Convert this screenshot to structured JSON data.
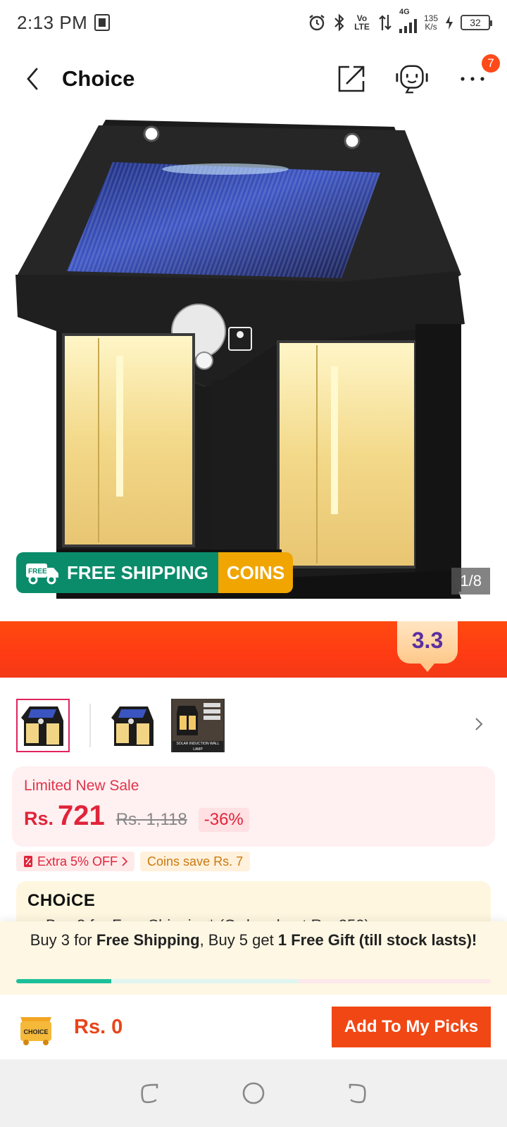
{
  "status_bar": {
    "time": "2:13 PM",
    "volte": "Vo LTE",
    "network": "4G",
    "speed_value": "135",
    "speed_unit": "K/s",
    "battery": "32"
  },
  "header": {
    "title": "Choice",
    "notification_count": "7"
  },
  "hero": {
    "image_counter": "1/8",
    "shipping_label": "FREE SHIPPING",
    "truck_label": "FREE",
    "coins_label": "COINS"
  },
  "promo": {
    "badge": "3.3"
  },
  "thumbnails": {
    "third_caption": "SOLAR INDUCTION WALL LAMP"
  },
  "price": {
    "sale_label": "Limited New Sale",
    "currency": "Rs.",
    "current": "721",
    "original": "Rs. 1,118",
    "discount": "-36%"
  },
  "tags": {
    "extra_off": "Extra 5% OFF",
    "coins_save": "Coins save Rs. 7"
  },
  "choice": {
    "logo": "CHOiCE",
    "peek_text": "Buy 3 for Free Shipping* (Order about Rs. 250)"
  },
  "bundle": {
    "part1": "Buy 3 for ",
    "part2": "Free Shipping",
    "part3": ", Buy 5 get ",
    "part4": "1 Free Gift (till stock lasts)!",
    "progress_first": 0.2,
    "progress_second": 0.395
  },
  "bottom": {
    "cart_label": "CHOICE",
    "total": "Rs. 0",
    "add_button": "Add To My Picks"
  },
  "colors": {
    "accent": "#f04714",
    "price_red": "#e0243a",
    "free_shipping_green": "#0a8c6b",
    "coins_gold": "#f0a500",
    "progress_teal": "#1dbf9a"
  }
}
